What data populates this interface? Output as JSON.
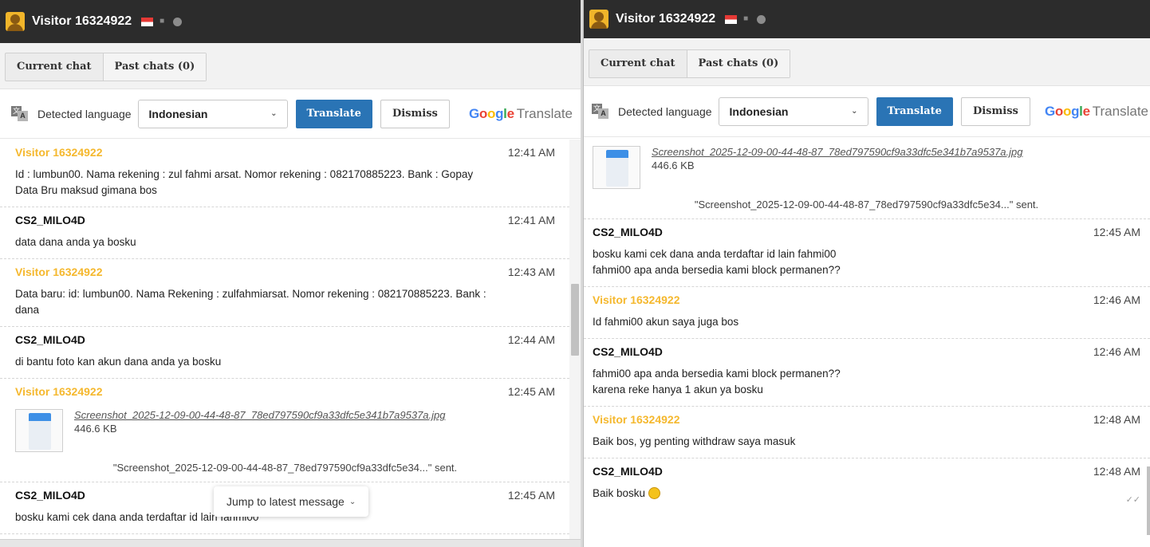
{
  "left": {
    "title": "Visitor 16324922",
    "tabs": [
      "Current chat",
      "Past chats (0)"
    ],
    "translate": {
      "detected_label": "Detected language",
      "language": "Indonesian",
      "translate_label": "Translate",
      "dismiss_label": "Dismiss",
      "brand_google": "Google",
      "brand_translate": "Translate"
    },
    "messages": [
      {
        "sender": "Visitor 16324922",
        "time": "12:41 AM",
        "text": "Id : lumbun00. Nama rekening : zul fahmi arsat. Nomor rekening : 082170885223. Bank : Gopay\nData Bru maksud gimana bos"
      },
      {
        "sender": "CS2_MILO4D",
        "time": "12:41 AM",
        "text": "data dana anda ya bosku"
      },
      {
        "sender": "Visitor 16324922",
        "time": "12:43 AM",
        "text": "Data baru: id: lumbun00. Nama Rekening : zulfahmiarsat. Nomor rekening : 082170885223. Bank : dana"
      },
      {
        "sender": "CS2_MILO4D",
        "time": "12:44 AM",
        "text": "di bantu foto kan akun dana anda ya bosku"
      },
      {
        "sender": "Visitor 16324922",
        "time": "12:45 AM",
        "file_name": "Screenshot_2025-12-09-00-44-48-87_78ed797590cf9a33dfc5e341b7a9537a.jpg",
        "file_size": "446.6 KB",
        "sent_note": "\"Screenshot_2025-12-09-00-44-48-87_78ed797590cf9a33dfc5e34...\" sent."
      },
      {
        "sender": "CS2_MILO4D",
        "time": "12:45 AM",
        "text": "bosku kami cek dana anda terdaftar id lain fahmi00"
      }
    ],
    "jump_label": "Jump to latest message"
  },
  "right": {
    "title": "Visitor 16324922",
    "tabs": [
      "Current chat",
      "Past chats (0)"
    ],
    "translate": {
      "detected_label": "Detected language",
      "language": "Indonesian",
      "translate_label": "Translate",
      "dismiss_label": "Dismiss",
      "brand_google": "Google",
      "brand_translate": "Translate"
    },
    "file_block": {
      "file_name": "Screenshot_2025-12-09-00-44-48-87_78ed797590cf9a33dfc5e341b7a9537a.jpg",
      "file_size": "446.6 KB",
      "sent_note": "\"Screenshot_2025-12-09-00-44-48-87_78ed797590cf9a33dfc5e34...\" sent."
    },
    "messages": [
      {
        "sender": "CS2_MILO4D",
        "time": "12:45 AM",
        "text": "bosku kami cek dana anda terdaftar id lain fahmi00\nfahmi00 apa anda bersedia kami block permanen??"
      },
      {
        "sender": "Visitor 16324922",
        "time": "12:46 AM",
        "text": "Id fahmi00 akun saya juga bos"
      },
      {
        "sender": "CS2_MILO4D",
        "time": "12:46 AM",
        "text": "fahmi00 apa anda bersedia kami block permanen??\nkarena reke hanya 1 akun ya bosku"
      },
      {
        "sender": "Visitor 16324922",
        "time": "12:48 AM",
        "text": "Baik bos, yg penting withdraw saya masuk"
      },
      {
        "sender": "CS2_MILO4D",
        "time": "12:48 AM",
        "text": "Baik bosku"
      }
    ]
  },
  "colors": {
    "visitor": "#f5b82e",
    "translate_button": "#2a74b5",
    "titlebar": "#2c2c2c"
  }
}
